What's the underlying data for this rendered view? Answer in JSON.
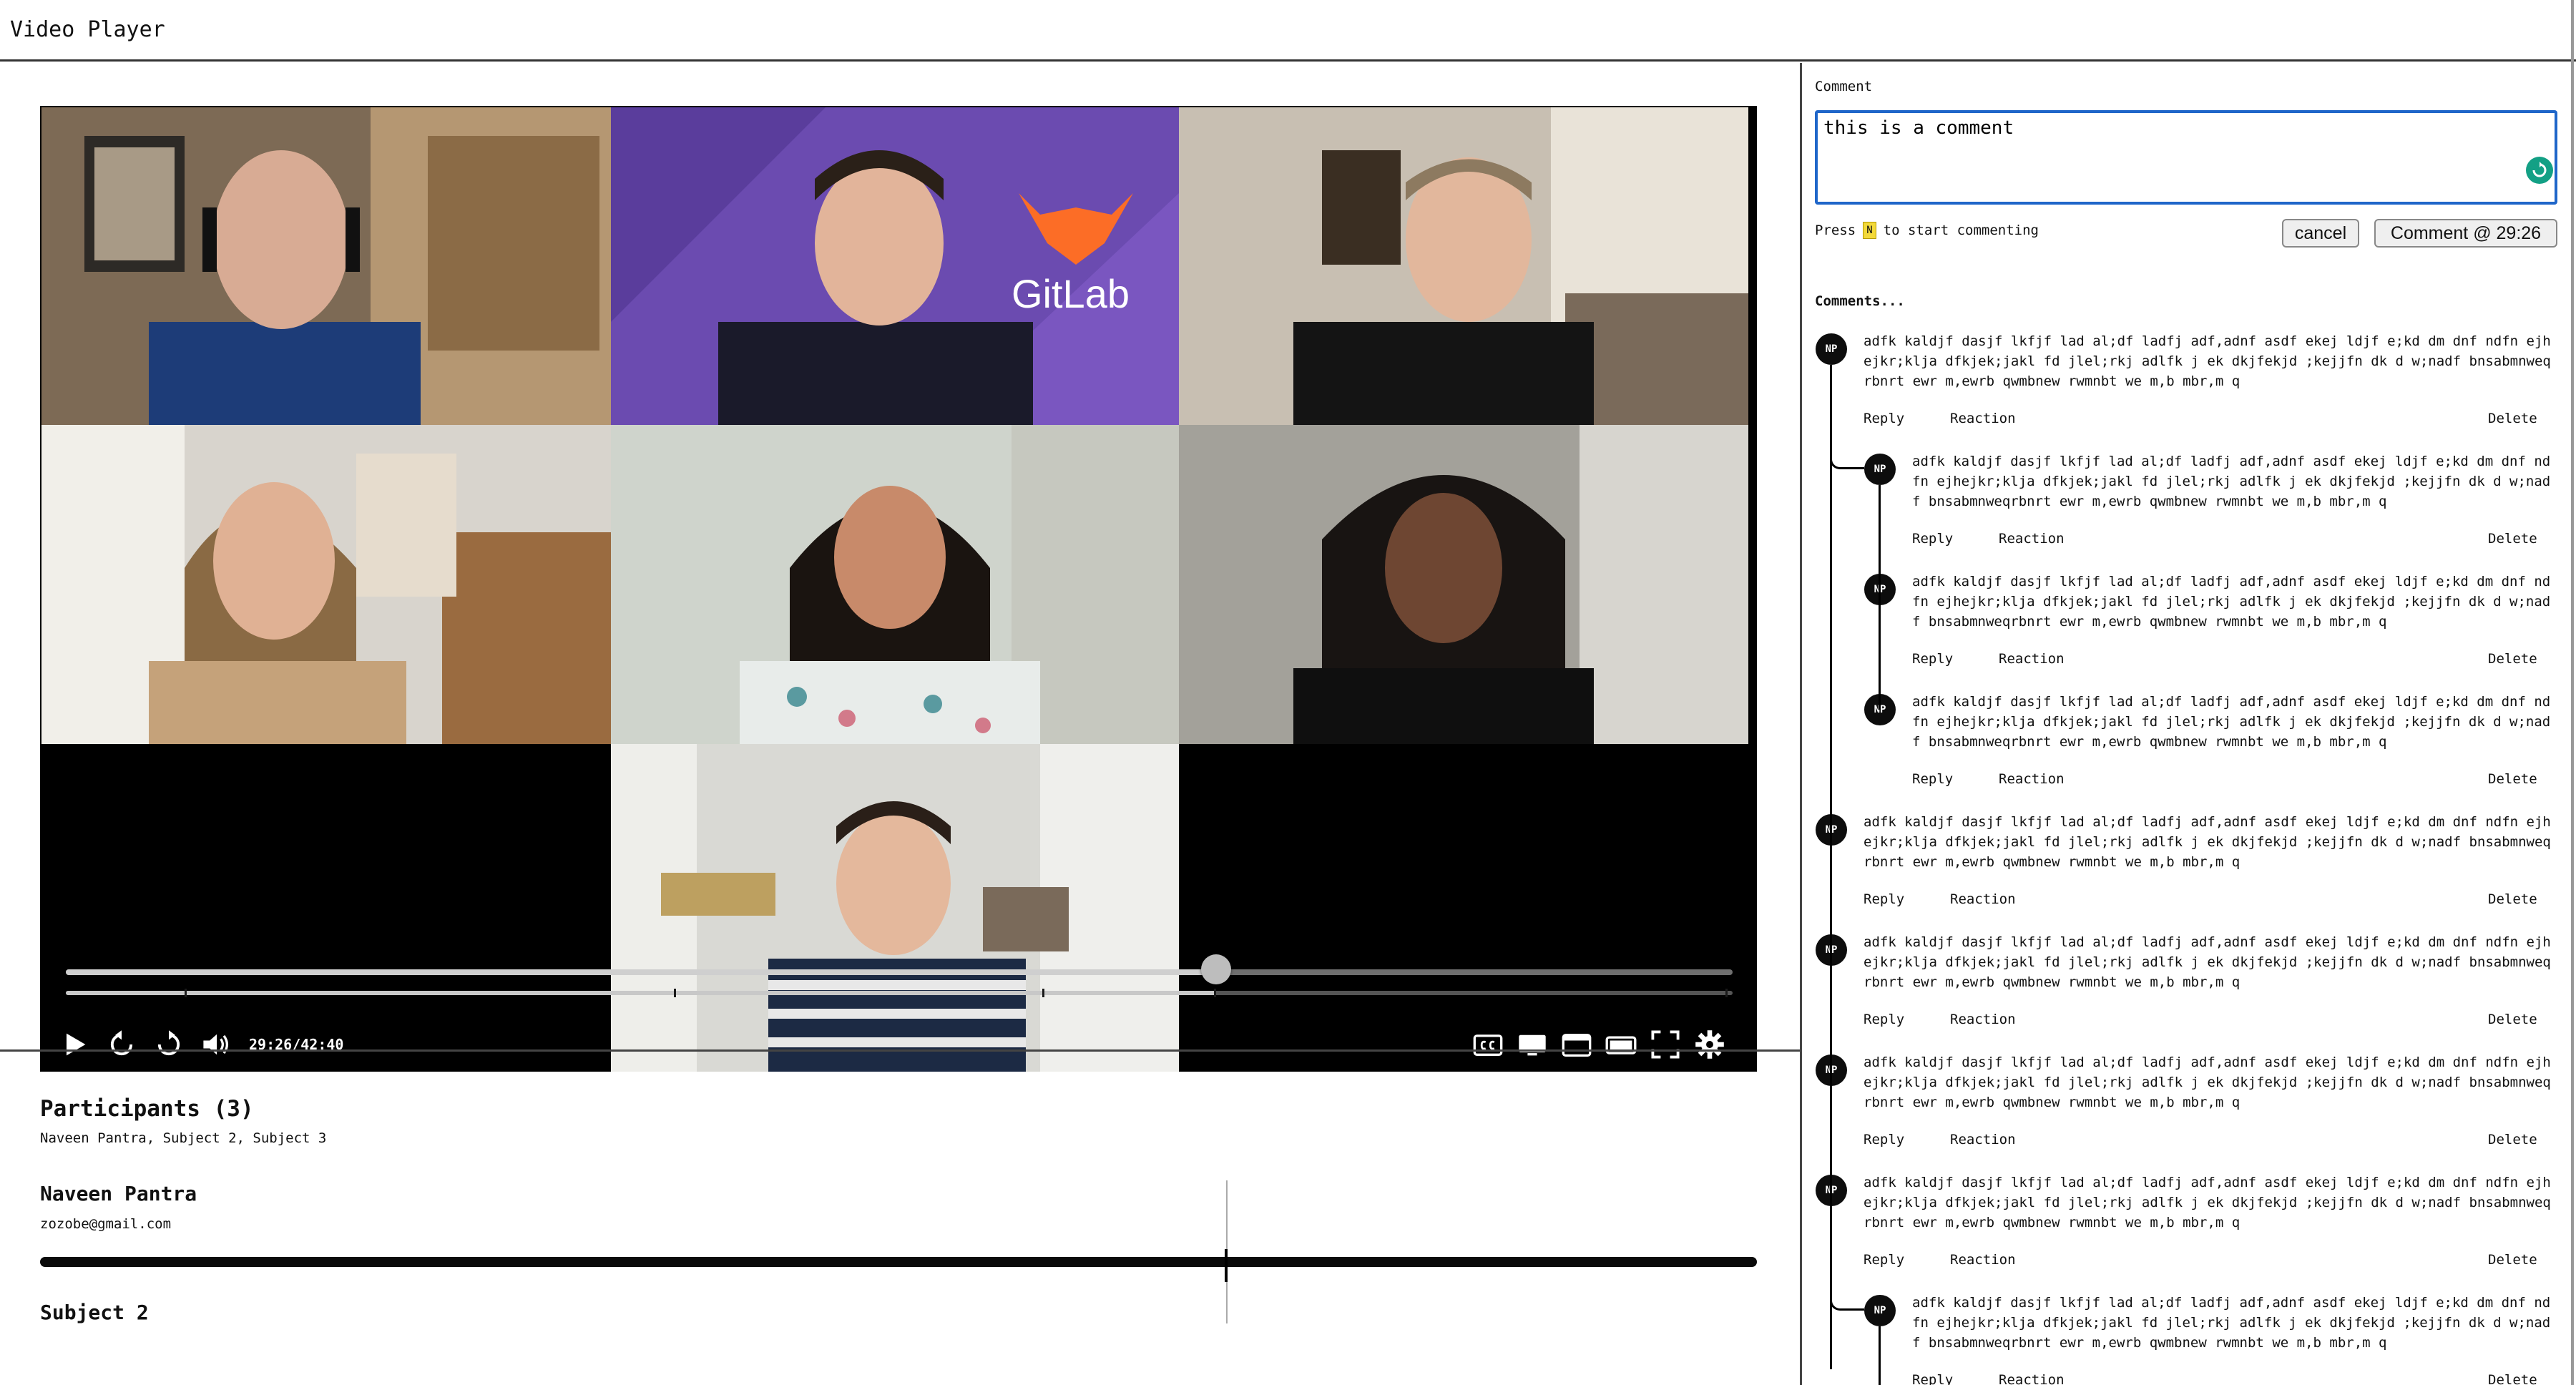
{
  "app": {
    "title": "Video Player"
  },
  "player": {
    "time_display": "29:26/42:40",
    "progress_fraction": 0.69,
    "buffer_fraction": 0.69,
    "watermark": "GitLab"
  },
  "participants": {
    "title": "Participants (3)",
    "summary": "Naveen Pantra, Subject 2, Subject 3",
    "items": [
      {
        "name": "Naveen Pantra",
        "email": "zozobe@gmail.com"
      },
      {
        "name": "Subject 2"
      }
    ]
  },
  "comment_form": {
    "label": "Comment",
    "value": "this is a comment",
    "hint_prefix": "Press",
    "hint_key": "N",
    "hint_suffix": "to start commenting",
    "cancel_label": "cancel",
    "submit_label": "Comment @ 29:26"
  },
  "comments": {
    "heading": "Comments...",
    "avatar_initials": "NP",
    "actions": {
      "reply": "Reply",
      "reaction": "Reaction",
      "delete": "Delete"
    },
    "items": [
      {
        "level": 0,
        "text": "adfk kaldjf dasjf lkfjf lad al;df ladfj adf,adnf asdf ekej ldjf e;kd dm dnf ndfn ejhejkr;klja dfkjek;jakl fd jlel;rkj adlfk j ek dkjfekjd ;kejjfn dk d w;nadf bnsabmnweqrbnrt ewr m,ewrb qwmbnew rwmnbt we m,b mbr,m q"
      },
      {
        "level": 1,
        "text": "adfk kaldjf dasjf lkfjf lad al;df ladfj adf,adnf asdf ekej ldjf e;kd dm dnf ndfn ejhejkr;klja dfkjek;jakl fd jlel;rkj adlfk j ek dkjfekjd ;kejjfn dk d w;nadf bnsabmnweqrbnrt ewr m,ewrb qwmbnew rwmnbt we m,b mbr,m q"
      },
      {
        "level": 1,
        "text": "adfk kaldjf dasjf lkfjf lad al;df ladfj adf,adnf asdf ekej ldjf e;kd dm dnf ndfn ejhejkr;klja dfkjek;jakl fd jlel;rkj adlfk j ek dkjfekjd ;kejjfn dk d w;nadf bnsabmnweqrbnrt ewr m,ewrb qwmbnew rwmnbt we m,b mbr,m q"
      },
      {
        "level": 1,
        "text": "adfk kaldjf dasjf lkfjf lad al;df ladfj adf,adnf asdf ekej ldjf e;kd dm dnf ndfn ejhejkr;klja dfkjek;jakl fd jlel;rkj adlfk j ek dkjfekjd ;kejjfn dk d w;nadf bnsabmnweqrbnrt ewr m,ewrb qwmbnew rwmnbt we m,b mbr,m q"
      },
      {
        "level": 0,
        "text": "adfk kaldjf dasjf lkfjf lad al;df ladfj adf,adnf asdf ekej ldjf e;kd dm dnf ndfn ejhejkr;klja dfkjek;jakl fd jlel;rkj adlfk j ek dkjfekjd ;kejjfn dk d w;nadf bnsabmnweqrbnrt ewr m,ewrb qwmbnew rwmnbt we m,b mbr,m q"
      },
      {
        "level": 0,
        "text": "adfk kaldjf dasjf lkfjf lad al;df ladfj adf,adnf asdf ekej ldjf e;kd dm dnf ndfn ejhejkr;klja dfkjek;jakl fd jlel;rkj adlfk j ek dkjfekjd ;kejjfn dk d w;nadf bnsabmnweqrbnrt ewr m,ewrb qwmbnew rwmnbt we m,b mbr,m q"
      },
      {
        "level": 0,
        "text": "adfk kaldjf dasjf lkfjf lad al;df ladfj adf,adnf asdf ekej ldjf e;kd dm dnf ndfn ejhejkr;klja dfkjek;jakl fd jlel;rkj adlfk j ek dkjfekjd ;kejjfn dk d w;nadf bnsabmnweqrbnrt ewr m,ewrb qwmbnew rwmnbt we m,b mbr,m q"
      },
      {
        "level": 0,
        "text": "adfk kaldjf dasjf lkfjf lad al;df ladfj adf,adnf asdf ekej ldjf e;kd dm dnf ndfn ejhejkr;klja dfkjek;jakl fd jlel;rkj adlfk j ek dkjfekjd ;kejjfn dk d w;nadf bnsabmnweqrbnrt ewr m,ewrb qwmbnew rwmnbt we m,b mbr,m q"
      },
      {
        "level": 1,
        "text": "adfk kaldjf dasjf lkfjf lad al;df ladfj adf,adnf asdf ekej ldjf e;kd dm dnf ndfn ejhejkr;klja dfkjek;jakl fd jlel;rkj adlfk j ek dkjfekjd ;kejjfn dk d w;nadf bnsabmnweqrbnrt ewr m,ewrb qwmbnew rwmnbt we m,b mbr,m q"
      }
    ]
  }
}
